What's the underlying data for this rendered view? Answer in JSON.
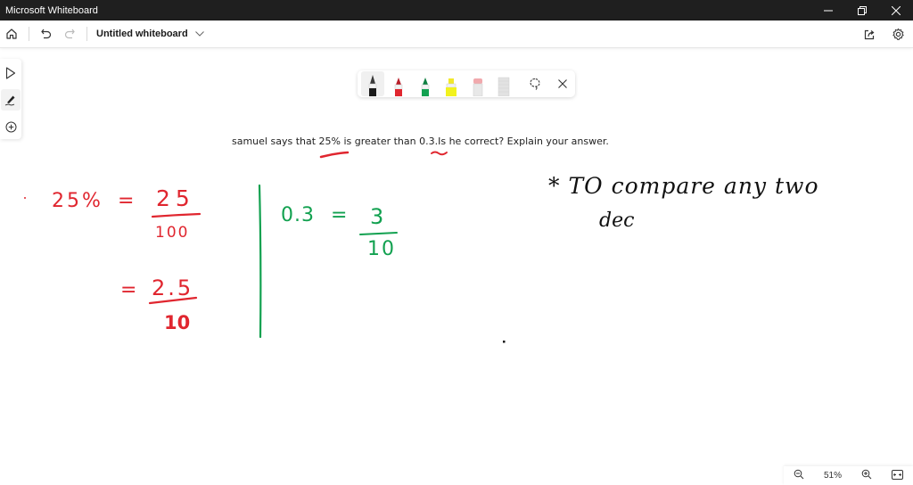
{
  "window": {
    "title": "Microsoft Whiteboard",
    "controls": [
      "minimize",
      "restore",
      "close"
    ]
  },
  "appbar": {
    "board_title": "Untitled whiteboard",
    "icons": [
      "home-icon",
      "undo-icon",
      "redo-icon",
      "chevron-down-icon",
      "share-icon",
      "settings-icon"
    ]
  },
  "left_rail": {
    "tools": [
      {
        "name": "select",
        "icon": "pointer-icon",
        "active": false
      },
      {
        "name": "inking",
        "icon": "pen-icon",
        "active": true
      },
      {
        "name": "add",
        "icon": "add-circle-icon",
        "active": false
      }
    ]
  },
  "ink_toolbar": {
    "pens": [
      {
        "name": "black-pen",
        "color": "#1a1a1a",
        "active": true
      },
      {
        "name": "red-pen",
        "color": "#e0262f",
        "active": false
      },
      {
        "name": "green-pen",
        "color": "#12a150",
        "active": false
      },
      {
        "name": "yellow-highlighter",
        "color": "#f2f21e",
        "active": false
      },
      {
        "name": "eraser",
        "color": "#f1a9ad",
        "active": false
      },
      {
        "name": "ruler",
        "color": "#d6d6d6",
        "active": false
      }
    ],
    "tools": [
      "lasso-icon",
      "close-icon"
    ]
  },
  "canvas": {
    "question_text": "samuel says that 25% is greater than 0.3.Is he correct? Explain your answer.",
    "ink": {
      "red_line1_left": "25%",
      "red_line1_eq": "=",
      "red_frac1_num": "25",
      "red_frac1_den": "100",
      "red_line2_eq": "=",
      "red_frac2_num": "2.5",
      "red_frac2_den": "10",
      "green_left": "0.3",
      "green_eq": "=",
      "green_num": "3",
      "green_den": "10",
      "black_line1": "* TO compare any two",
      "black_line2": "dec"
    },
    "ink_colors": {
      "red": "#e0262f",
      "green": "#12a150",
      "black": "#111111"
    }
  },
  "zoom": {
    "level": "51%",
    "icons": [
      "zoom-out-icon",
      "zoom-in-icon",
      "fit-to-screen-icon"
    ]
  }
}
